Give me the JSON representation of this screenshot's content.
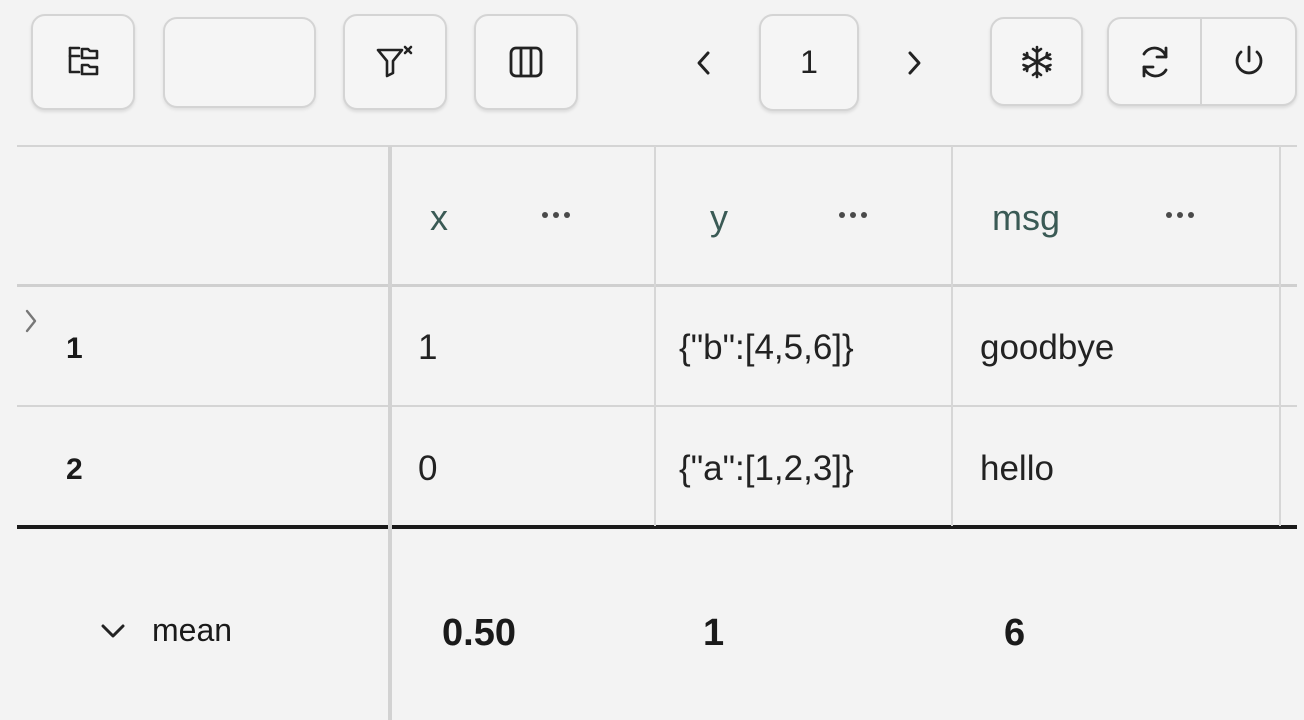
{
  "toolbar": {
    "group_icon": "tree-group-icon",
    "search": {
      "value": "",
      "placeholder": ""
    },
    "clear_filter_icon": "filter-clear-icon",
    "columns_icon": "columns-icon",
    "pagination": {
      "prev": "‹",
      "page": "1",
      "next": "›"
    },
    "freeze_icon": "snowflake-icon",
    "refresh_icon": "refresh-icon",
    "power_icon": "power-icon"
  },
  "columns": [
    {
      "label": "x",
      "menu": "column-menu-icon"
    },
    {
      "label": "y",
      "menu": "column-menu-icon"
    },
    {
      "label": "msg",
      "menu": "column-menu-icon"
    }
  ],
  "rows": [
    {
      "index": "1",
      "x": "1",
      "y": "{\"b\":[4,5,6]}",
      "msg": "goodbye",
      "expand_icon": "chevron-right-icon"
    },
    {
      "index": "2",
      "x": "0",
      "y": "{\"a\":[1,2,3]}",
      "msg": "hello"
    }
  ],
  "summary": {
    "label": "mean",
    "toggle_icon": "chevron-down-icon",
    "x": "0.50",
    "y": "1",
    "msg": "6"
  }
}
